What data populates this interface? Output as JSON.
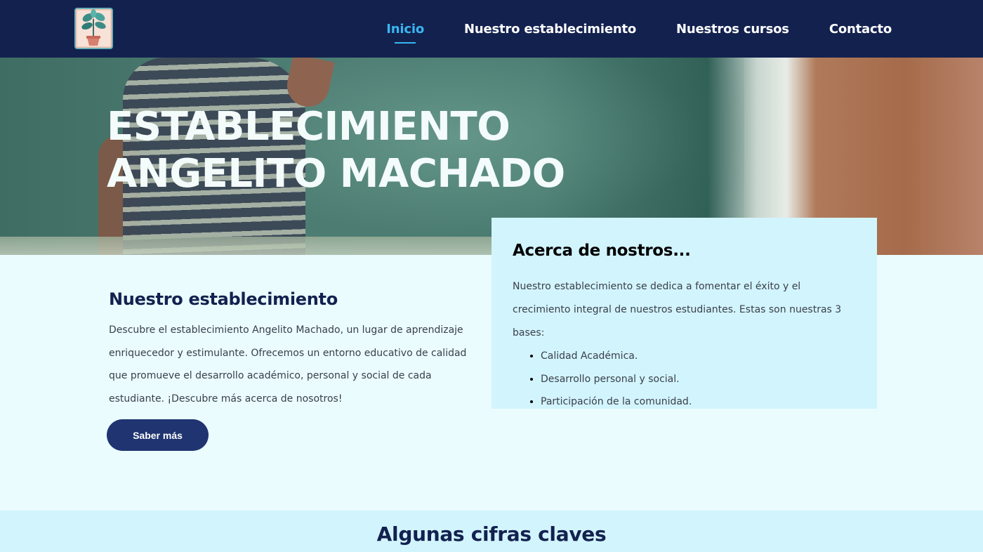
{
  "nav": {
    "items": [
      {
        "label": "Inicio",
        "active": true
      },
      {
        "label": "Nuestro establecimiento",
        "active": false
      },
      {
        "label": "Nuestros cursos",
        "active": false
      },
      {
        "label": "Contacto",
        "active": false
      }
    ]
  },
  "hero": {
    "title_line1": "ESTABLECIMIENTO",
    "title_line2": "ANGELITO MACHADO"
  },
  "about": {
    "title": "Acerca de nostros...",
    "text": "Nuestro establecimiento se dedica a fomentar el éxito y el crecimiento integral de nuestros estudiantes. Estas son nuestras 3 bases:",
    "bases": [
      "Calidad Académica.",
      "Desarrollo personal y social.",
      "Participación de la comunidad."
    ]
  },
  "establecimiento": {
    "title": "Nuestro establecimiento",
    "text": "Descubre el establecimiento Angelito Machado, un lugar de aprendizaje enriquecedor y estimulante. Ofrecemos un entorno educativo de calidad que promueve el desarrollo académico, personal y social de cada estudiante. ¡Descubre más acerca de nosotros!",
    "button_label": "Saber más"
  },
  "cifras": {
    "title": "Algunas cifras claves"
  },
  "colors": {
    "header_bg": "#13214f",
    "nav_active": "#39b6f0",
    "page_bg": "#eafcfe",
    "card_bg": "#d2f4fd",
    "button_bg": "#1f3470"
  },
  "icons": {
    "logo": "plant-book-logo-icon"
  }
}
